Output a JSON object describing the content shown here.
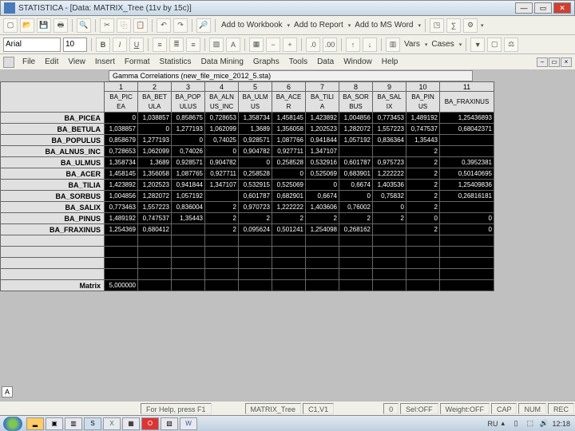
{
  "window": {
    "title": "STATISTICA - [Data: MATRIX_Tree (11v by 15c)]"
  },
  "toolbar1": {
    "add_workbook": "Add to Workbook",
    "add_report": "Add to Report",
    "add_word": "Add to MS Word"
  },
  "toolbar2": {
    "font": "Arial",
    "size": "10",
    "vars": "Vars",
    "cases": "Cases"
  },
  "menu": [
    "File",
    "Edit",
    "View",
    "Insert",
    "Format",
    "Statistics",
    "Data Mining",
    "Graphs",
    "Tools",
    "Data",
    "Window",
    "Help"
  ],
  "sheet": {
    "title": "Gamma Correlations (new_file_mice_2012_5.sta)",
    "col_nums": [
      "1",
      "2",
      "3",
      "4",
      "5",
      "6",
      "7",
      "8",
      "9",
      "10",
      "11"
    ],
    "col_heads": [
      "BA_PIC\nEA",
      "BA_BET\nULA",
      "BA_POP\nULUS",
      "BA_ALN\nUS_INC",
      "BA_ULM\nUS",
      "BA_ACE\nR",
      "BA_TILI\nA",
      "BA_SOR\nBUS",
      "BA_SAL\nIX",
      "BA_PIN\nUS",
      "BA_FRAXINUS"
    ],
    "rows": [
      {
        "h": "BA_PICEA",
        "c": [
          "0",
          "1,038857",
          "0,858675",
          "0,728653",
          "1,358734",
          "1,458145",
          "1,423892",
          "1,004856",
          "0,773453",
          "1,489192",
          "1,25436893"
        ]
      },
      {
        "h": "BA_BETULA",
        "c": [
          "1,038857",
          "0",
          "1,277193",
          "1,062099",
          "1,3689",
          "1,356058",
          "1,202523",
          "1,282072",
          "1,557223",
          "0,747537",
          "0,68042371"
        ]
      },
      {
        "h": "BA_POPULUS",
        "c": [
          "0,858679",
          "1,277193",
          "0",
          "0,74025",
          "0,928571",
          "1,087766",
          "0,941844",
          "1,057192",
          "0,836364",
          "1,35443",
          ""
        ]
      },
      {
        "h": "BA_ALNUS_INC",
        "c": [
          "0,728653",
          "1,062099",
          "0,74026",
          "0",
          "0,904782",
          "0,927711",
          "1,347107",
          "",
          "",
          "2",
          ""
        ]
      },
      {
        "h": "BA_ULMUS",
        "c": [
          "1,358734",
          "1,3689",
          "0,928571",
          "0,904782",
          "0",
          "0,258528",
          "0,532916",
          "0,601787",
          "0,975723",
          "2",
          "0,3952381"
        ]
      },
      {
        "h": "BA_ACER",
        "c": [
          "1,458145",
          "1,356058",
          "1,087765",
          "0,927711",
          "0,258528",
          "0",
          "0,525069",
          "0,683901",
          "1,222222",
          "2",
          "0,50140695"
        ]
      },
      {
        "h": "BA_TILIA",
        "c": [
          "1,423892",
          "1,202523",
          "0,941844",
          "1,347107",
          "0,532915",
          "0,525069",
          "0",
          "0,6674",
          "1,403536",
          "2",
          "1,25409836"
        ]
      },
      {
        "h": "BA_SORBUS",
        "c": [
          "1,004856",
          "1,282072",
          "1,057192",
          "",
          "0,601787",
          "0,682901",
          "0,6674",
          "0",
          "0,75832",
          "2",
          "0,26816181"
        ]
      },
      {
        "h": "BA_SALIX",
        "c": [
          "0,773463",
          "1,557223",
          "0,836004",
          "2",
          "0,970723",
          "1,222222",
          "1,403606",
          "0,76002",
          "0",
          "2",
          ""
        ]
      },
      {
        "h": "BA_PINUS",
        "c": [
          "1,489192",
          "0,747537",
          "1,35443",
          "2",
          "2",
          "2",
          "2",
          "2",
          "2",
          "0",
          "0"
        ]
      },
      {
        "h": "BA_FRAXINUS",
        "c": [
          "1,254369",
          "0,680412",
          "",
          "2",
          "0,095624",
          "0,501241",
          "1,254098",
          "0,268162",
          "",
          "2",
          "0"
        ]
      }
    ],
    "matrix_row": {
      "h": "Matrix",
      "c": [
        "5,000000",
        "",
        "",
        "",
        "",
        "",
        "",
        "",
        "",
        "",
        ""
      ]
    }
  },
  "status": {
    "help": "For Help, press F1",
    "doc": "MATRIX_Tree",
    "pos": "C1,V1",
    "val": "0",
    "sel": "Sel:OFF",
    "weight": "Weight:OFF",
    "cap": "CAP",
    "num": "NUM",
    "rec": "REC"
  },
  "tray": {
    "lang": "RU",
    "time": "12:18"
  },
  "chart_data": {
    "type": "table",
    "title": "Gamma Correlations (new_file_mice_2012_5.sta)",
    "row_labels": [
      "BA_PICEA",
      "BA_BETULA",
      "BA_POPULUS",
      "BA_ALNUS_INC",
      "BA_ULMUS",
      "BA_ACER",
      "BA_TILIA",
      "BA_SORBUS",
      "BA_SALIX",
      "BA_PINUS",
      "BA_FRAXINUS"
    ],
    "col_labels": [
      "BA_PICEA",
      "BA_BETULA",
      "BA_POPULUS",
      "BA_ALNUS_INC",
      "BA_ULMUS",
      "BA_ACER",
      "BA_TILIA",
      "BA_SORBUS",
      "BA_SALIX",
      "BA_PINUS",
      "BA_FRAXINUS"
    ],
    "matrix": [
      [
        0,
        1.038857,
        0.858675,
        0.728653,
        1.358734,
        1.458145,
        1.423892,
        1.004856,
        0.773453,
        1.489192,
        1.25436893
      ],
      [
        1.038857,
        0,
        1.277193,
        1.062099,
        1.3689,
        1.356058,
        1.202523,
        1.282072,
        1.557223,
        0.747537,
        0.68042371
      ],
      [
        0.858679,
        1.277193,
        0,
        0.74025,
        0.928571,
        1.087766,
        0.941844,
        1.057192,
        0.836364,
        1.35443,
        null
      ],
      [
        0.728653,
        1.062099,
        0.74026,
        0,
        0.904782,
        0.927711,
        1.347107,
        null,
        null,
        2,
        null
      ],
      [
        1.358734,
        1.3689,
        0.928571,
        0.904782,
        0,
        0.258528,
        0.532916,
        0.601787,
        0.975723,
        2,
        0.3952381
      ],
      [
        1.458145,
        1.356058,
        1.087765,
        0.927711,
        0.258528,
        0,
        0.525069,
        0.683901,
        1.222222,
        2,
        0.50140695
      ],
      [
        1.423892,
        1.202523,
        0.941844,
        1.347107,
        0.532915,
        0.525069,
        0,
        0.6674,
        1.403536,
        2,
        1.25409836
      ],
      [
        1.004856,
        1.282072,
        1.057192,
        null,
        0.601787,
        0.682901,
        0.6674,
        0,
        0.75832,
        2,
        0.26816181
      ],
      [
        0.773463,
        1.557223,
        0.836004,
        2,
        0.970723,
        1.222222,
        1.403606,
        0.76002,
        0,
        2,
        null
      ],
      [
        1.489192,
        0.747537,
        1.35443,
        2,
        2,
        2,
        2,
        2,
        2,
        0,
        0
      ],
      [
        1.254369,
        0.680412,
        null,
        2,
        0.095624,
        0.501241,
        1.254098,
        0.268162,
        null,
        2,
        0
      ]
    ],
    "matrix_summary": 5.0
  }
}
